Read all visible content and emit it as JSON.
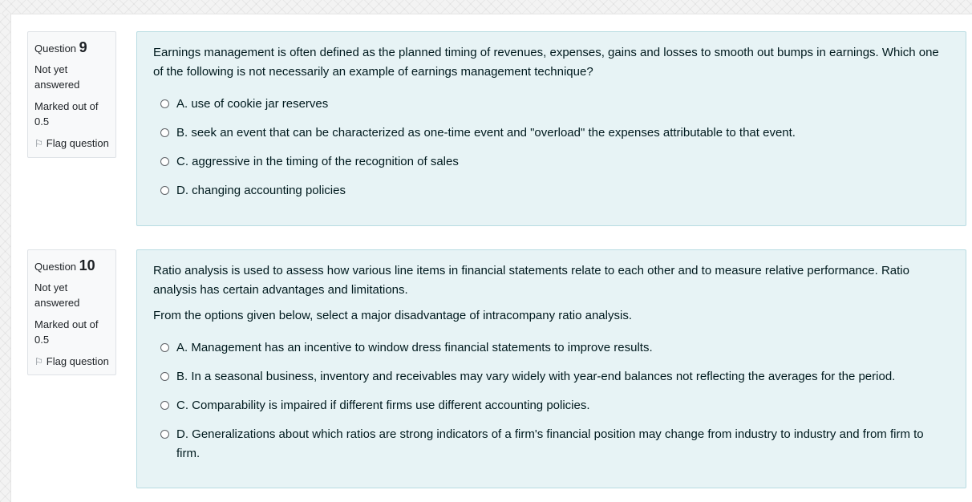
{
  "questions": [
    {
      "label": "Question",
      "number": "9",
      "status": "Not yet answered",
      "marked": "Marked out of 0.5",
      "flag": "Flag question",
      "text": [
        "Earnings management is often defined as the planned timing of revenues, expenses, gains and losses to smooth out bumps in earnings. Which one of the following is not necessarily an example of earnings management technique?"
      ],
      "answers": [
        "A. use of cookie jar reserves",
        "B. seek an event that can be characterized as one-time event and \"overload\" the expenses attributable to that event.",
        "C. aggressive in the timing of the recognition of sales",
        "D. changing accounting policies"
      ]
    },
    {
      "label": "Question",
      "number": "10",
      "status": "Not yet answered",
      "marked": "Marked out of 0.5",
      "flag": "Flag question",
      "text": [
        "Ratio analysis is used to assess how various line items in financial statements relate to each other and to measure relative performance. Ratio analysis has certain advantages and limitations.",
        "From the options given below, select a major disadvantage of intracompany ratio analysis."
      ],
      "answers": [
        "A. Management has an incentive to window dress financial statements to improve results.",
        "B. In a seasonal business, inventory and receivables may vary widely with year-end balances not reflecting the averages for the period.",
        "C. Comparability is impaired if different firms use different accounting policies.",
        "D. Generalizations about which ratios are strong indicators of a firm's financial position may change from industry to industry and from firm to firm."
      ]
    }
  ]
}
